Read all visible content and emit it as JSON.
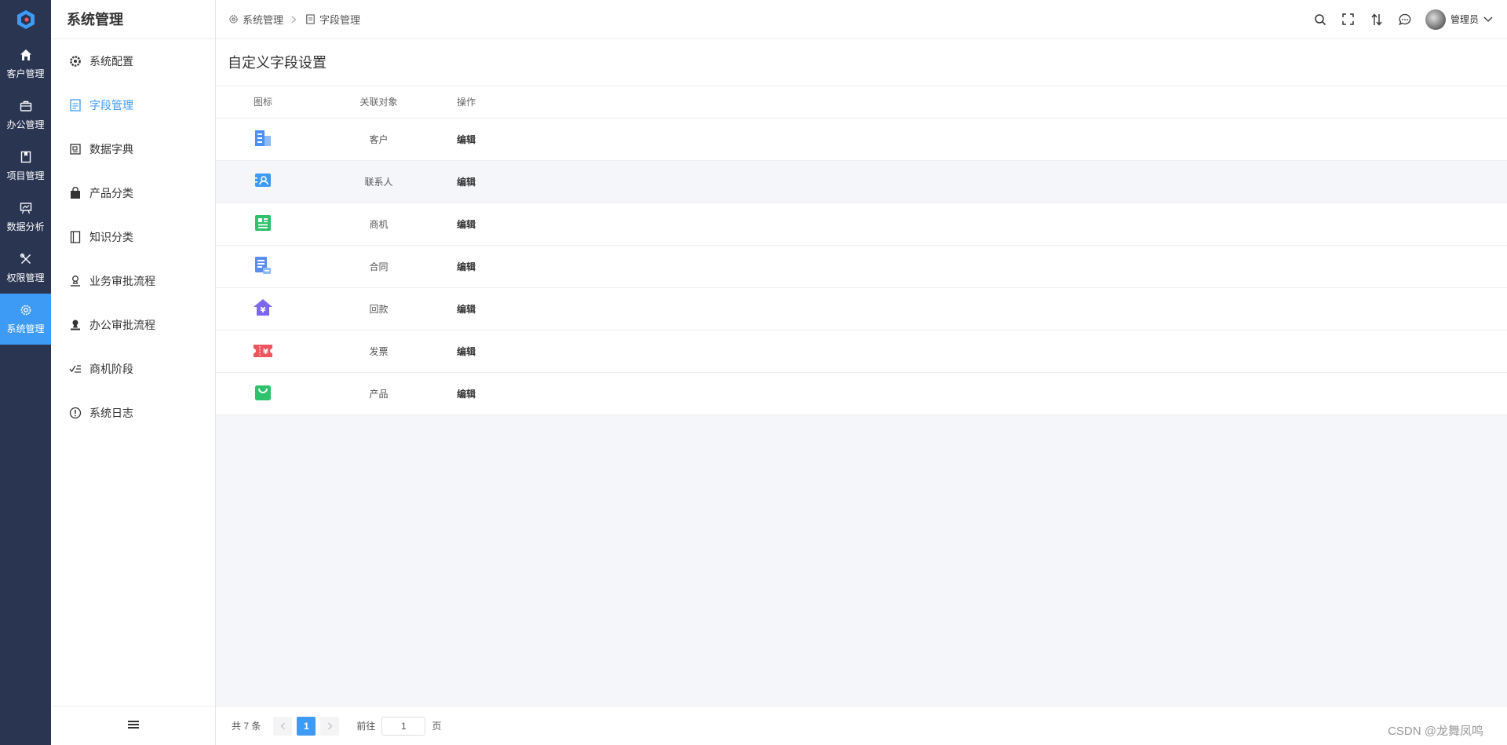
{
  "rail": {
    "items": [
      {
        "label": "客户管理",
        "icon": "home-icon"
      },
      {
        "label": "办公管理",
        "icon": "briefcase-icon"
      },
      {
        "label": "项目管理",
        "icon": "book-icon"
      },
      {
        "label": "数据分析",
        "icon": "chart-board-icon"
      },
      {
        "label": "权限管理",
        "icon": "tools-icon"
      },
      {
        "label": "系统管理",
        "icon": "gear-icon",
        "active": true
      }
    ]
  },
  "sidebar": {
    "title": "系统管理",
    "items": [
      {
        "label": "系统配置",
        "icon": "gear-icon"
      },
      {
        "label": "字段管理",
        "icon": "document-icon",
        "active": true
      },
      {
        "label": "数据字典",
        "icon": "dictionary-icon"
      },
      {
        "label": "产品分类",
        "icon": "bag-icon"
      },
      {
        "label": "知识分类",
        "icon": "notebook-icon"
      },
      {
        "label": "业务审批流程",
        "icon": "stamp-icon"
      },
      {
        "label": "办公审批流程",
        "icon": "stamp-filled-icon"
      },
      {
        "label": "商机阶段",
        "icon": "check-list-icon"
      },
      {
        "label": "系统日志",
        "icon": "info-circle-icon"
      }
    ]
  },
  "breadcrumb": {
    "level1": "系统管理",
    "level2": "字段管理"
  },
  "header": {
    "user_name": "管理员"
  },
  "main": {
    "title": "自定义字段设置",
    "columns": {
      "icon": "图标",
      "object": "关联对象",
      "action": "操作"
    },
    "rows": [
      {
        "object": "客户",
        "action": "编辑",
        "icon": "building-icon",
        "color": "#4a90f5"
      },
      {
        "object": "联系人",
        "action": "编辑",
        "icon": "contact-card-icon",
        "color": "#3e9bf5"
      },
      {
        "object": "商机",
        "action": "编辑",
        "icon": "opportunity-icon",
        "color": "#2dc26b"
      },
      {
        "object": "合同",
        "action": "编辑",
        "icon": "contract-icon",
        "color": "#5b8def"
      },
      {
        "object": "回款",
        "action": "编辑",
        "icon": "payment-house-icon",
        "color": "#7b68ee"
      },
      {
        "object": "发票",
        "action": "编辑",
        "icon": "invoice-icon",
        "color": "#f0545e"
      },
      {
        "object": "产品",
        "action": "编辑",
        "icon": "shopping-bag-icon",
        "color": "#2dc26b"
      }
    ]
  },
  "pagination": {
    "total": "共 7 条",
    "current_page": "1",
    "goto_label": "前往",
    "goto_value": "1",
    "page_suffix": "页"
  },
  "watermark": "CSDN @龙舞凤鸣",
  "colors": {
    "rail_bg": "#2a3552",
    "accent": "#3e9bf5"
  }
}
